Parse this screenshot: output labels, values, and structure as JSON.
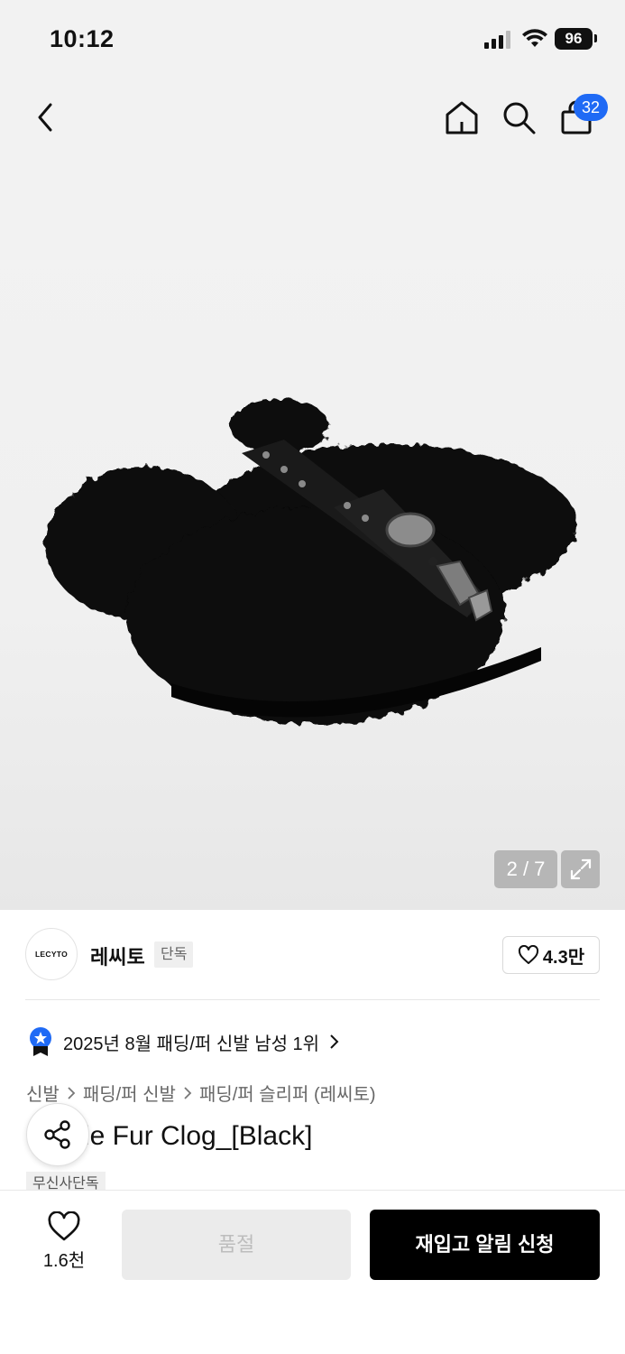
{
  "status_bar": {
    "time": "10:12",
    "battery": "96"
  },
  "nav": {
    "cart_count": "32",
    "icons": [
      "back-icon",
      "home-icon",
      "search-icon",
      "bag-icon"
    ]
  },
  "gallery": {
    "counter": "2 / 7"
  },
  "brand": {
    "logo_text": "LECYTO",
    "name": "레씨토",
    "tag": "단독",
    "likes": "4.3만"
  },
  "ranking": {
    "text": "2025년 8월 패딩/퍼 신발 남성 1위",
    "accent": "#1f6af5"
  },
  "breadcrumb": {
    "items": [
      "신발",
      "패딩/퍼 신발",
      "패딩/퍼 슬리퍼 (레씨토)"
    ]
  },
  "product": {
    "title_visible": "…kle Fur Clog_[Black]",
    "title_shown": "le Fur Clog_[Black]",
    "exclusive_tag": "무신사단독"
  },
  "bottom": {
    "wish_count": "1.6천",
    "soldout_label": "품절",
    "restock_label": "재입고 알림 신청"
  }
}
